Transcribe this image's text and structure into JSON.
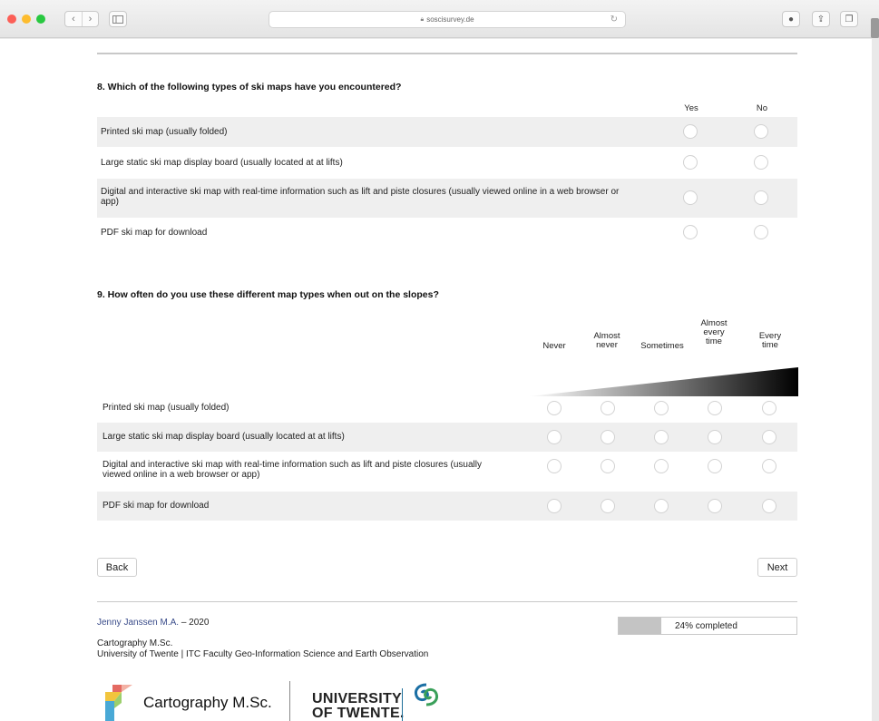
{
  "browser": {
    "url": "soscisurvey.de"
  },
  "colors": {
    "close": "#fc5f57",
    "minimize": "#fdbc2e",
    "maximize": "#28c840",
    "row_shade": "#efefef",
    "author_link": "#3a4c8a"
  },
  "q8": {
    "title": "8. Which of the following types of ski maps have you encountered?",
    "columns": [
      "Yes",
      "No"
    ],
    "rows": [
      "Printed ski map (usually folded)",
      "Large static ski map display board (usually located at at lifts)",
      "Digital and interactive ski map with real-time information such as lift and piste closures (usually viewed online in a web browser or app)",
      "PDF ski map for download"
    ]
  },
  "q9": {
    "title": "9. How often do you use these different map types when out on the slopes?",
    "columns": [
      "Never",
      "Almost never",
      "Sometimes",
      "Almost every time",
      "Every time"
    ],
    "rows": [
      "Printed ski map (usually folded)",
      "Large static ski map display board (usually located at at lifts)",
      "Digital and interactive ski map with real-time information such as lift and piste closures (usually viewed online in a web browser or app)",
      "PDF ski map for download"
    ]
  },
  "nav": {
    "back_label": "Back",
    "next_label": "Next"
  },
  "footer": {
    "author_name": "Jenny Janssen M.A.",
    "author_year": "– 2020",
    "program": "Cartography M.Sc.",
    "institution": "University of Twente | ITC Faculty Geo-Information Science and Earth Observation",
    "progress_percent": 24,
    "progress_text": "24% completed",
    "logo_cartography": "Cartography M.Sc.",
    "logo_university_line1": "UNIVERSITY",
    "logo_university_line2": "OF TWENTE.",
    "logo_itc": "ITC"
  }
}
